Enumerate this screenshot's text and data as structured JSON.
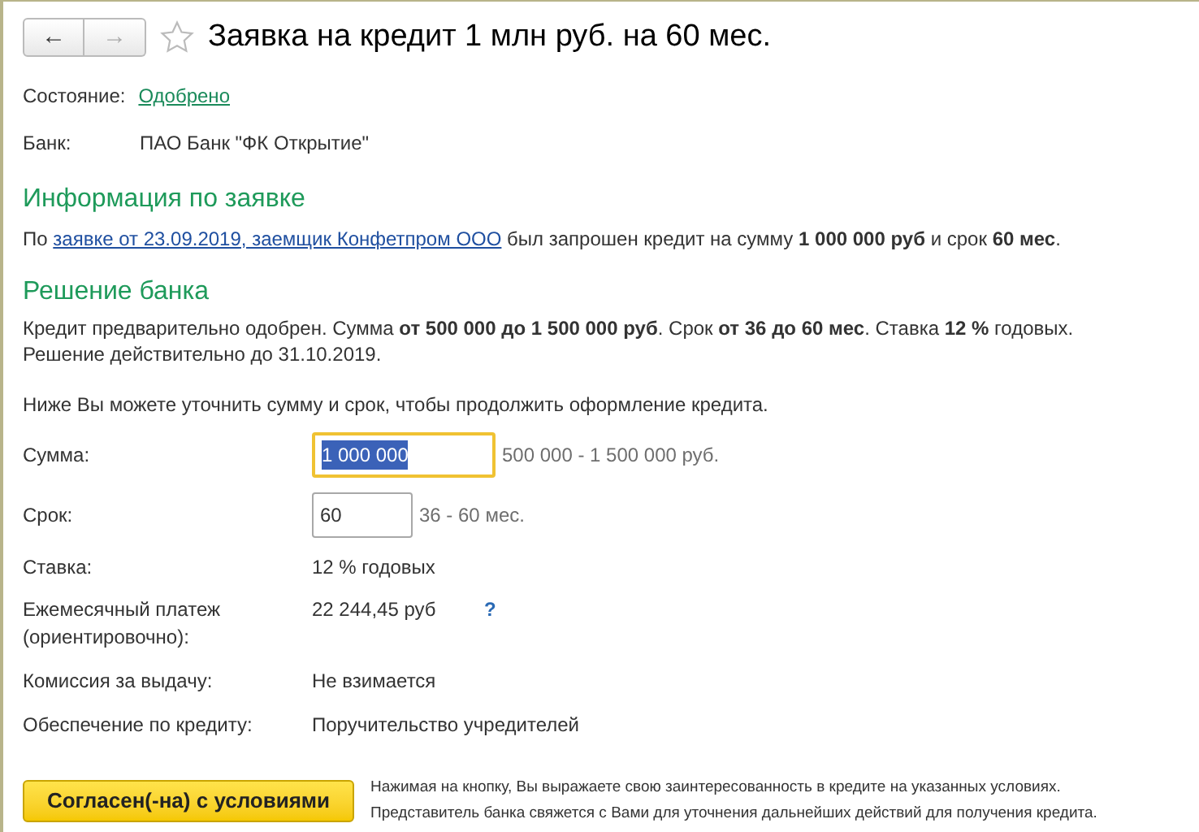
{
  "window": {
    "title": "Заявка на кредит 1 млн руб. на 60 мес.",
    "back": "←",
    "forward": "→",
    "favorite": false
  },
  "status": {
    "label": "Состояние:",
    "value": "Одобрено"
  },
  "bank": {
    "label": "Банк:",
    "value": "ПАО Банк \"ФК Открытие\""
  },
  "info": {
    "heading": "Информация по заявке",
    "prefix": "По",
    "link": "заявке от 23.09.2019, заемщик Конфетпром ООО",
    "text": "был запрошен кредит на сумму **1 000 000 руб** и срок **60 мес**."
  },
  "decision": {
    "heading": "Решение банка",
    "text": "Кредит предварительно одобрен. Сумма **от 500 000 до 1 500 000 руб**. Срок **от 36 до 60 мес**. Ставка **12 %** годовых.",
    "validity": "Решение действительно до 31.10.2019.",
    "note": "Ниже Вы можете уточнить сумму и срок, чтобы продолжить оформление кредита."
  },
  "fields": [
    {
      "kind": "input",
      "label": "Сумма:",
      "value": "1 000 000",
      "hint": "500 000 - 1 500 000 руб.",
      "focused": true,
      "wide": true
    },
    {
      "kind": "input",
      "label": "Срок:",
      "value": "60",
      "hint": "36 - 60 мес.",
      "focused": false,
      "wide": false
    },
    {
      "kind": "text",
      "label": "Ставка:",
      "value": "12 % годовых"
    },
    {
      "kind": "help",
      "label": "Ежемесячный платеж (ориентировочно):",
      "value": "22 244,45 руб",
      "help": "?"
    },
    {
      "kind": "text",
      "label": "Комиссия за выдачу:",
      "value": "Не взимается"
    },
    {
      "kind": "text",
      "label": "Обеспечение по кредиту:",
      "value": "Поручительство учредителей"
    }
  ],
  "agree": {
    "button": "Согласен(-на) с условиями",
    "notes": [
      "Нажимая на кнопку, Вы выражаете свою заинтересованность в кредите на указанных условиях.",
      "Представитель банка свяжется с Вами для уточнения дальнейших действий для получения кредита."
    ]
  }
}
